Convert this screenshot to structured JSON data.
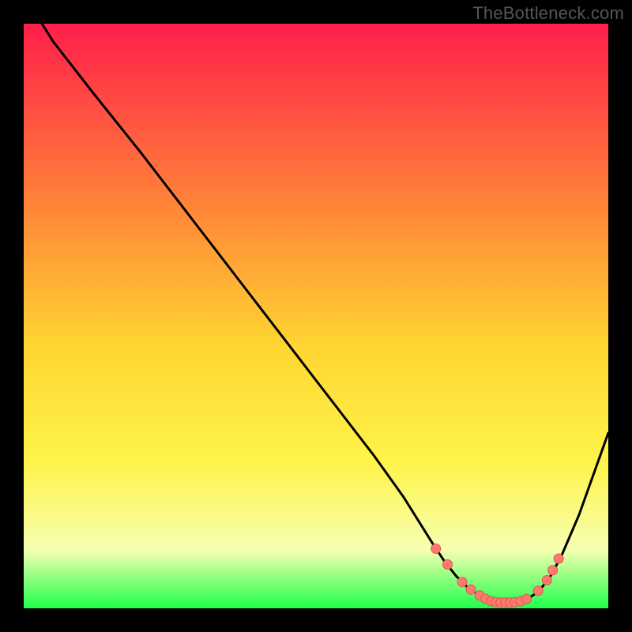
{
  "watermark": "TheBottleneck.com",
  "colors": {
    "gradient_top": "#ff1f4b",
    "gradient_mid1": "#ff7a3a",
    "gradient_mid2": "#ffd531",
    "gradient_mid3": "#fff44a",
    "gradient_mid4": "#f6ffb1",
    "gradient_bottom": "#1fff4b",
    "curve": "#000000",
    "marker_fill": "#ff7a6e",
    "marker_stroke": "#d8584c"
  },
  "chart_data": {
    "type": "line",
    "title": "",
    "xlabel": "",
    "ylabel": "",
    "xlim": [
      0,
      100
    ],
    "ylim": [
      0,
      100
    ],
    "grid": false,
    "legend": false,
    "series": [
      {
        "name": "bottleneck-curve",
        "x": [
          0,
          5,
          12,
          20,
          30,
          40,
          50,
          60,
          65,
          70,
          72,
          74,
          76,
          78,
          80,
          82,
          84,
          86,
          88,
          90,
          92,
          95,
          100
        ],
        "y": [
          105,
          97,
          88,
          78,
          65,
          52,
          39,
          26,
          19,
          11,
          8,
          5.5,
          3.5,
          2.2,
          1.4,
          1.0,
          1.0,
          1.5,
          2.8,
          5.3,
          9,
          16,
          30
        ]
      }
    ],
    "markers": {
      "name": "highlight-points",
      "x": [
        70.5,
        72.5,
        75,
        76.5,
        78,
        79,
        80,
        80.8,
        81.6,
        82.4,
        83.2,
        84,
        85,
        86,
        88,
        89.5,
        90.5,
        91.5
      ],
      "y": [
        10.2,
        7.5,
        4.5,
        3.2,
        2.2,
        1.6,
        1.2,
        1.05,
        1.0,
        1.0,
        1.0,
        1.05,
        1.2,
        1.6,
        3.0,
        4.8,
        6.5,
        8.5
      ]
    }
  }
}
